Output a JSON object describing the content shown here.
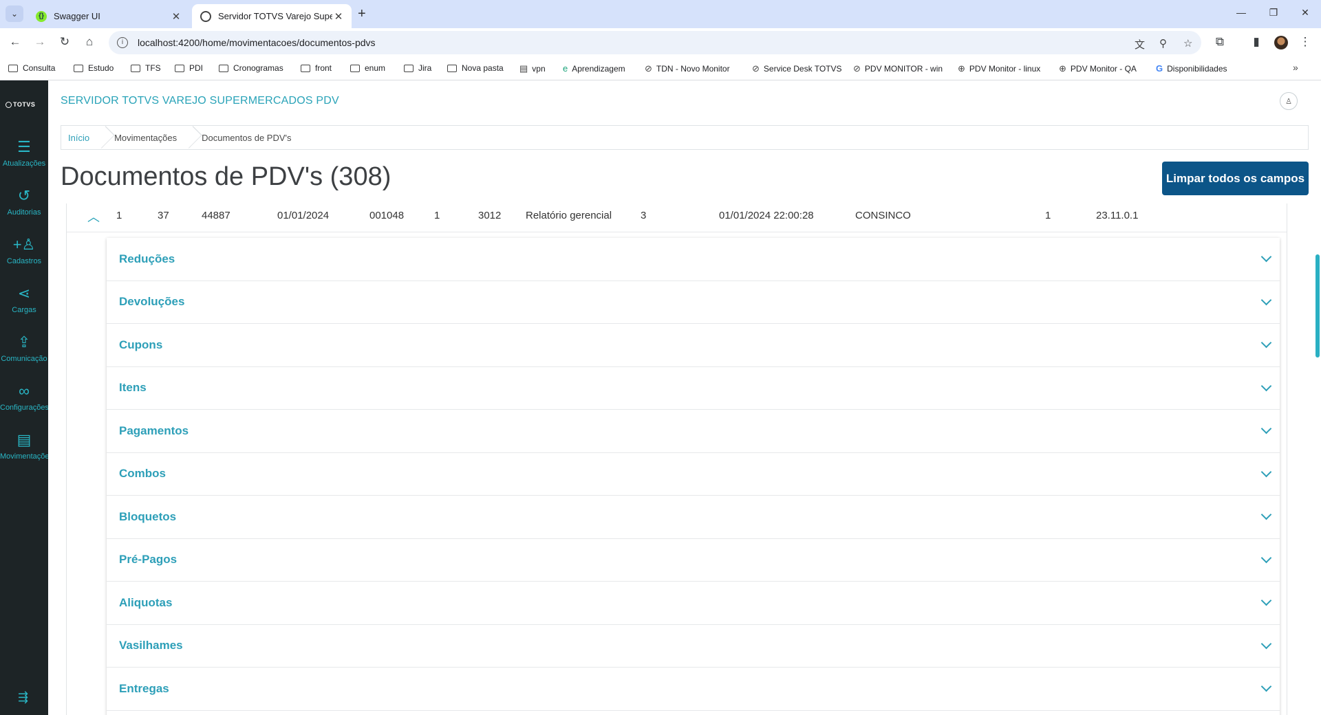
{
  "browser": {
    "tabs": [
      {
        "title": "Swagger UI",
        "active": false
      },
      {
        "title": "Servidor TOTVS Varejo Supermercados PDV",
        "active": true
      }
    ],
    "url": "localhost:4200/home/movimentacoes/documentos-pdvs",
    "bookmarks": [
      {
        "label": "Consulta",
        "icon": "folder-icon"
      },
      {
        "label": "Estudo",
        "icon": "folder-icon"
      },
      {
        "label": "TFS",
        "icon": "folder-icon"
      },
      {
        "label": "PDI",
        "icon": "folder-icon"
      },
      {
        "label": "Cronogramas",
        "icon": "folder-icon"
      },
      {
        "label": "front",
        "icon": "folder-icon"
      },
      {
        "label": "enum",
        "icon": "folder-icon"
      },
      {
        "label": "Jira",
        "icon": "folder-icon"
      },
      {
        "label": "Nova pasta",
        "icon": "folder-icon"
      },
      {
        "label": "vpn",
        "icon": "document-icon"
      },
      {
        "label": "Aprendizagem",
        "icon": "edge-icon"
      },
      {
        "label": "TDN - Novo Monitor",
        "icon": "totvs-icon"
      },
      {
        "label": "Service Desk TOTVS",
        "icon": "totvs-icon"
      },
      {
        "label": "PDV MONITOR - win",
        "icon": "totvs-icon"
      },
      {
        "label": "PDV Monitor - linux",
        "icon": "globe-icon"
      },
      {
        "label": "PDV Monitor - QA",
        "icon": "globe-icon"
      },
      {
        "label": "Disponibilidades",
        "icon": "google-icon"
      }
    ]
  },
  "sidebar": {
    "logo": "TOTVS",
    "items": [
      {
        "label": "Atualizações",
        "icon": "server-icon"
      },
      {
        "label": "Auditorias",
        "icon": "history-icon"
      },
      {
        "label": "Cadastros",
        "icon": "add-user-icon"
      },
      {
        "label": "Cargas",
        "icon": "share-icon"
      },
      {
        "label": "Comunicação",
        "icon": "upload-icon"
      },
      {
        "label": "Configurações",
        "icon": "link-icon"
      },
      {
        "label": "Movimentações",
        "icon": "book-icon"
      }
    ]
  },
  "header": {
    "app_title": "SERVIDOR TOTVS VAREJO SUPERMERCADOS PDV"
  },
  "breadcrumb": [
    "Início",
    "Movimentações",
    "Documentos de PDV's"
  ],
  "page": {
    "title": "Documentos de PDV's (308)",
    "clear_button": "Limpar todos os campos"
  },
  "row": [
    "1",
    "37",
    "44887",
    "01/01/2024",
    "001048",
    "1",
    "3012",
    "Relatório gerencial",
    "3",
    "01/01/2024 22:00:28",
    "CONSINCO",
    "1",
    "23.11.0.1"
  ],
  "sections": [
    "Reduções",
    "Devoluções",
    "Cupons",
    "Itens",
    "Pagamentos",
    "Combos",
    "Bloquetos",
    "Pré-Pagos",
    "Aliquotas",
    "Vasilhames",
    "Entregas"
  ],
  "colors": {
    "accent": "#29a3b8",
    "primary_button": "#0c5588",
    "sidebar_bg": "#1d2426"
  }
}
